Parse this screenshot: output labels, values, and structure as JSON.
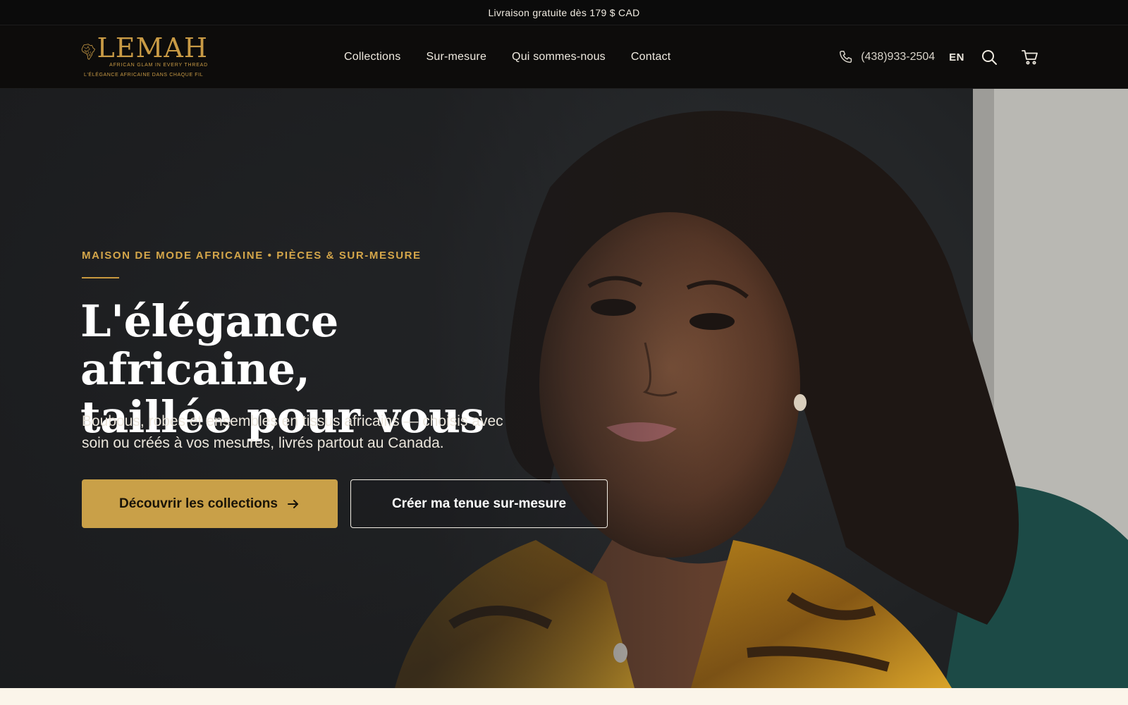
{
  "announcement": {
    "text": "Livraison gratuite dès 179 $ CAD"
  },
  "header": {
    "logo": {
      "name": "LEMAH",
      "tagline_en": "AFRICAN GLAM IN EVERY THREAD",
      "tagline_fr": "L'ÉLÉGANCE AFRICAINE DANS CHAQUE FIL",
      "icon": "africa-map-icon"
    },
    "nav": [
      {
        "label": "Collections"
      },
      {
        "label": "Sur-mesure"
      },
      {
        "label": "Qui sommes-nous"
      },
      {
        "label": "Contact"
      }
    ],
    "phone": {
      "icon": "phone-icon",
      "number": "(438)933-2504"
    },
    "language": "EN",
    "search_icon": "search-icon",
    "cart_icon": "cart-icon"
  },
  "hero": {
    "eyebrow": "MAISON DE MODE AFRICAINE • PIÈCES & SUR-MESURE",
    "title_line1": "L'élégance africaine,",
    "title_line2": "taillée pour vous",
    "subtitle": "Boubous, robes et ensembles en tissus africains — choisis avec soin ou créés à vos mesures, livrés partout au Canada.",
    "primary_cta": "Découvrir les collections",
    "primary_cta_icon": "arrow-right-icon",
    "secondary_cta": "Créer ma tenue sur-mesure"
  },
  "colors": {
    "accent_gold": "#c9a048",
    "header_bg": "#0d0c0b",
    "cream": "#fbf5ea"
  }
}
